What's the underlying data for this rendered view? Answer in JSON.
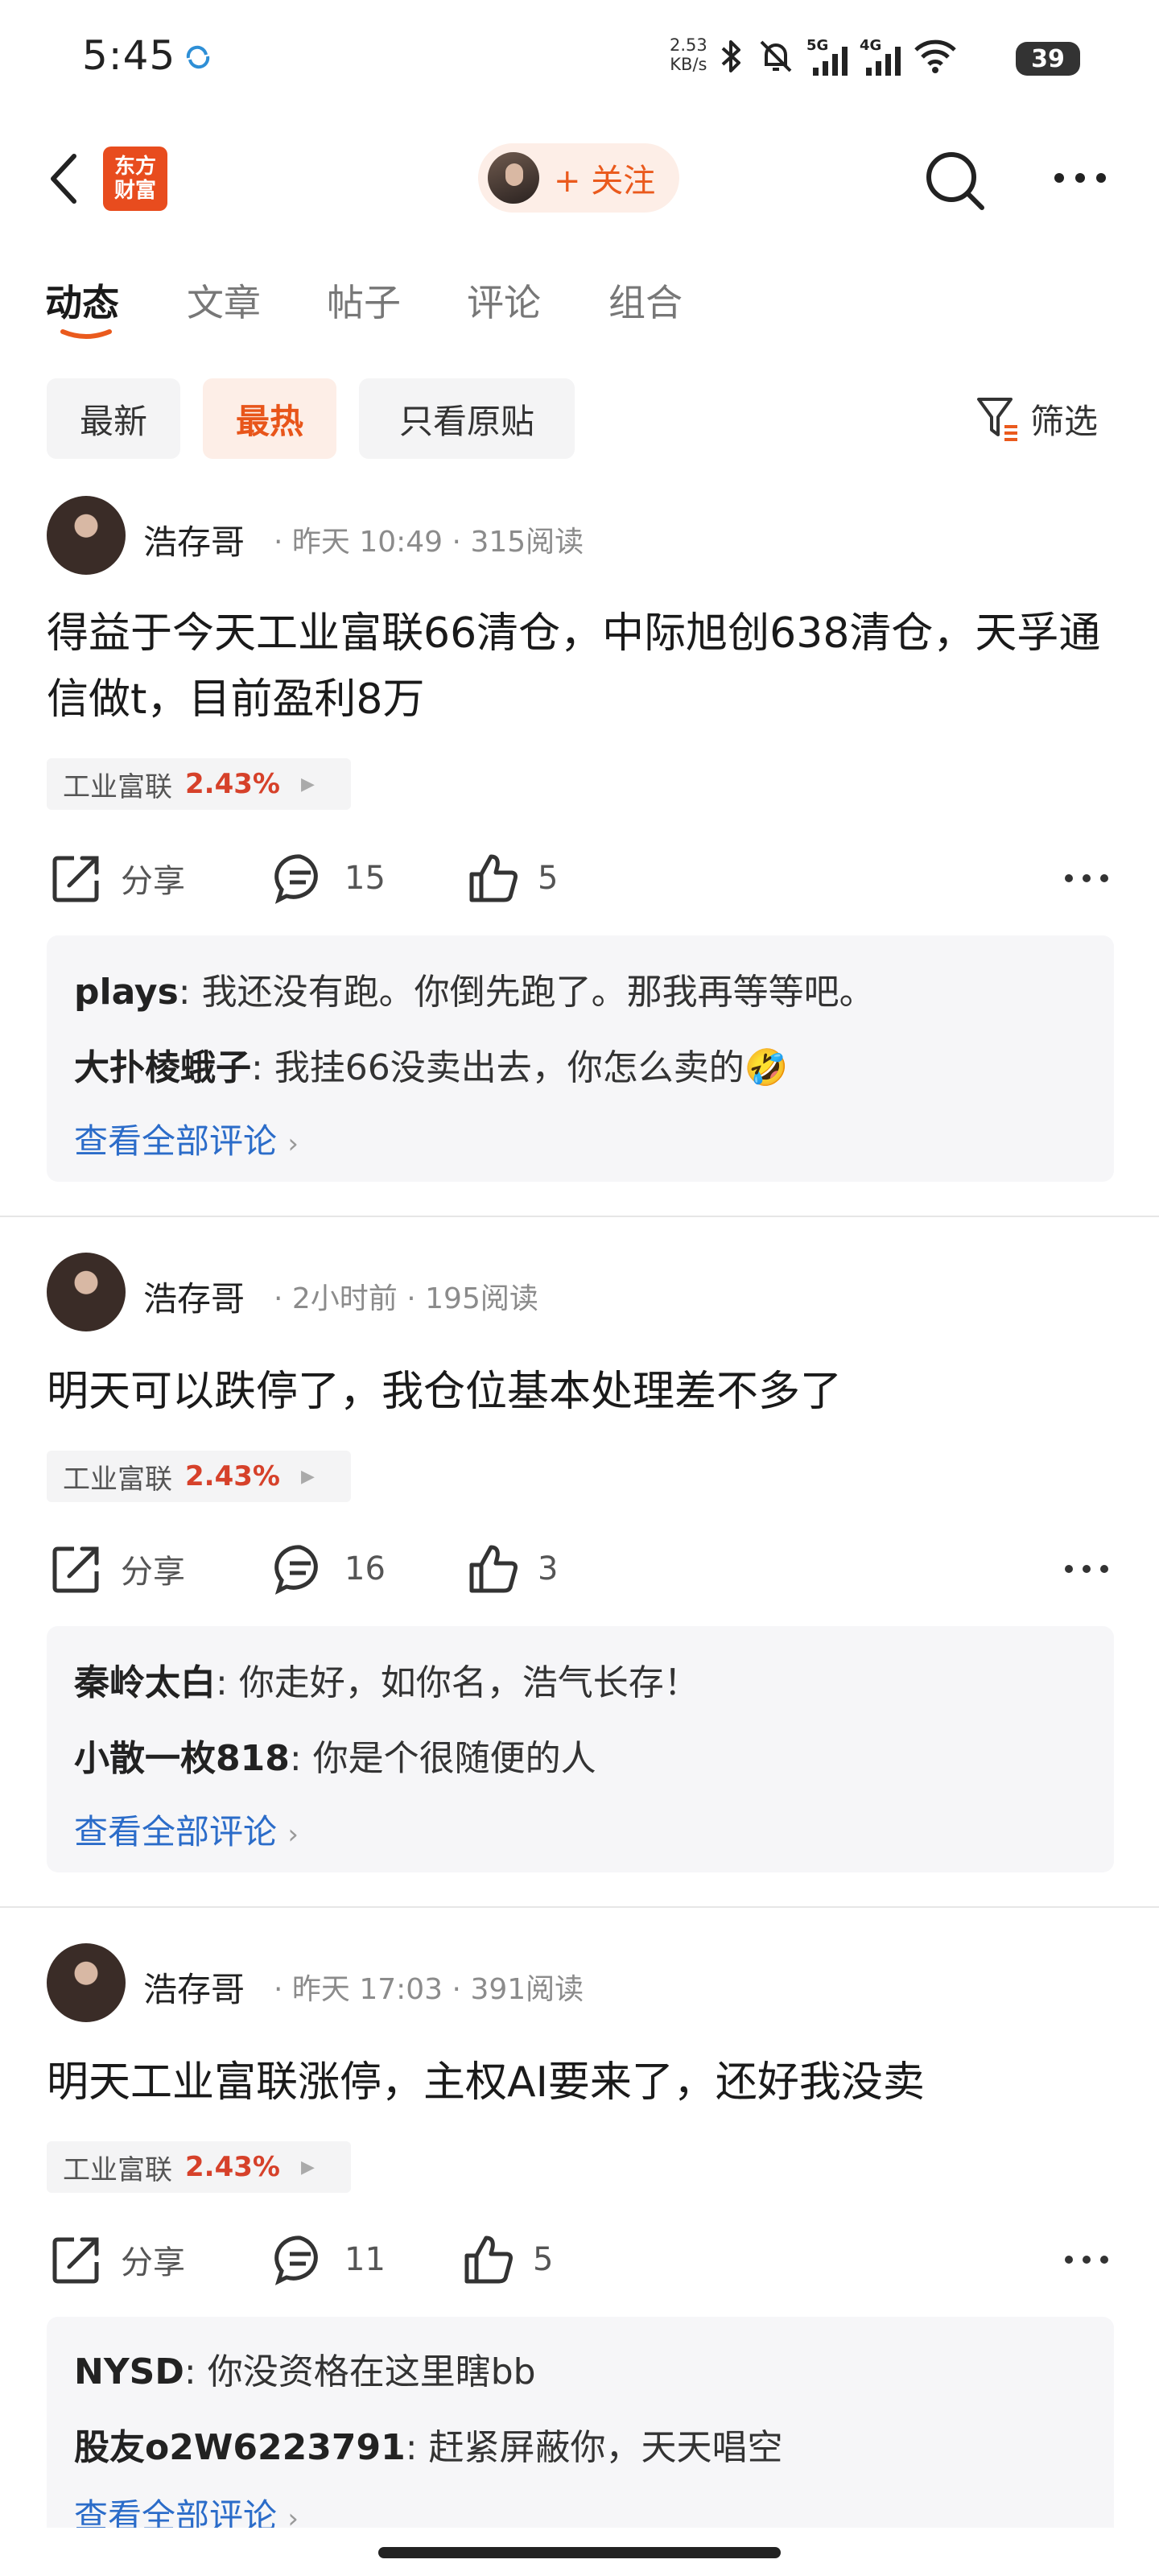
{
  "status_bar": {
    "time": "5:45",
    "net_speed_value": "2.53",
    "net_speed_unit": "KB/s",
    "signal_5g": "5G",
    "signal_4g": "4G",
    "battery": "39"
  },
  "header": {
    "logo_line1": "东方",
    "logo_line2": "财富",
    "follow_label": "+ 关注"
  },
  "tabs": [
    {
      "label": "动态",
      "active": true
    },
    {
      "label": "文章",
      "active": false
    },
    {
      "label": "帖子",
      "active": false
    },
    {
      "label": "评论",
      "active": false
    },
    {
      "label": "组合",
      "active": false
    }
  ],
  "filters": {
    "chips": [
      {
        "label": "最新",
        "active": false
      },
      {
        "label": "最热",
        "active": true
      },
      {
        "label": "只看原贴",
        "active": false
      }
    ],
    "filter_label": "筛选"
  },
  "posts": [
    {
      "author": "浩存哥",
      "time": "昨天 10:49",
      "reads": "315阅读",
      "text": "得益于今天工业富联66清仓，中际旭创638清仓，天孚通信做t，目前盈利8万",
      "stock": {
        "name": "工业富联",
        "change": "2.43%"
      },
      "share_label": "分享",
      "comments": "15",
      "likes": "5",
      "replies": [
        {
          "user": "plays",
          "text": "我还没有跑。你倒先跑了。那我再等等吧。"
        },
        {
          "user": "大扑棱蛾子",
          "text": "我挂66没卖出去，你怎么卖的🤣"
        }
      ],
      "view_all": "查看全部评论"
    },
    {
      "author": "浩存哥",
      "time": "2小时前",
      "reads": "195阅读",
      "text": "明天可以跌停了，我仓位基本处理差不多了",
      "stock": {
        "name": "工业富联",
        "change": "2.43%"
      },
      "share_label": "分享",
      "comments": "16",
      "likes": "3",
      "replies": [
        {
          "user": "秦岭太白",
          "text": "你走好，如你名，浩气长存！"
        },
        {
          "user": "小散一枚818",
          "text": "你是个很随便的人"
        }
      ],
      "view_all": "查看全部评论"
    },
    {
      "author": "浩存哥",
      "time": "昨天 17:03",
      "reads": "391阅读",
      "text": "明天工业富联涨停，主权AI要来了，还好我没卖",
      "stock": {
        "name": "工业富联",
        "change": "2.43%"
      },
      "share_label": "分享",
      "comments": "11",
      "likes": "5",
      "replies": [
        {
          "user": "NYSD",
          "text": "你没资格在这里瞎bb"
        },
        {
          "user": "股友o2W6223791",
          "text": "赶紧屏蔽你，天天唱空"
        }
      ],
      "view_all": "查看全部评论"
    }
  ],
  "colors": {
    "accent": "#ea5a1d",
    "stock_up": "#d6412a",
    "link": "#2b6cc9"
  }
}
